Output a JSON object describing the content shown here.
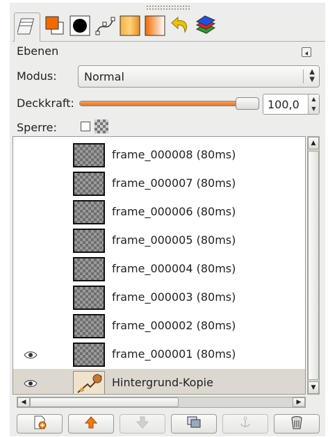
{
  "dialog": {
    "title": "Ebenen",
    "tabs": [
      {
        "icon": "layers-icon",
        "active": true
      },
      {
        "icon": "colors-icon"
      },
      {
        "icon": "brushes-icon"
      },
      {
        "icon": "paths-icon"
      },
      {
        "icon": "patterns-icon"
      },
      {
        "icon": "gradients-icon"
      },
      {
        "icon": "undo-history-icon"
      },
      {
        "icon": "palettes-icon"
      }
    ]
  },
  "controls": {
    "mode_label": "Modus:",
    "mode_value": "Normal",
    "opacity_label": "Deckkraft:",
    "opacity_value": "100,0",
    "opacity_fraction": 1.0,
    "lock_label": "Sperre:"
  },
  "layers": [
    {
      "name": "frame_000008 (80ms)",
      "visible": false,
      "selected": false
    },
    {
      "name": "frame_000007 (80ms)",
      "visible": false,
      "selected": false
    },
    {
      "name": "frame_000006 (80ms)",
      "visible": false,
      "selected": false
    },
    {
      "name": "frame_000005 (80ms)",
      "visible": false,
      "selected": false
    },
    {
      "name": "frame_000004 (80ms)",
      "visible": false,
      "selected": false
    },
    {
      "name": "frame_000003 (80ms)",
      "visible": false,
      "selected": false
    },
    {
      "name": "frame_000002 (80ms)",
      "visible": false,
      "selected": false
    },
    {
      "name": "frame_000001 (80ms)",
      "visible": true,
      "selected": false
    },
    {
      "name": "Hintergrund-Kopie",
      "visible": true,
      "selected": true
    }
  ],
  "buttons": [
    {
      "icon": "new-layer-icon",
      "enabled": true
    },
    {
      "icon": "raise-layer-icon",
      "enabled": true
    },
    {
      "icon": "lower-layer-icon",
      "enabled": false
    },
    {
      "icon": "duplicate-layer-icon",
      "enabled": true
    },
    {
      "icon": "anchor-layer-icon",
      "enabled": false
    },
    {
      "icon": "delete-layer-icon",
      "enabled": true
    }
  ],
  "colors": {
    "accent_orange": "#e8731d",
    "selected_row": "#dcd8d0"
  }
}
